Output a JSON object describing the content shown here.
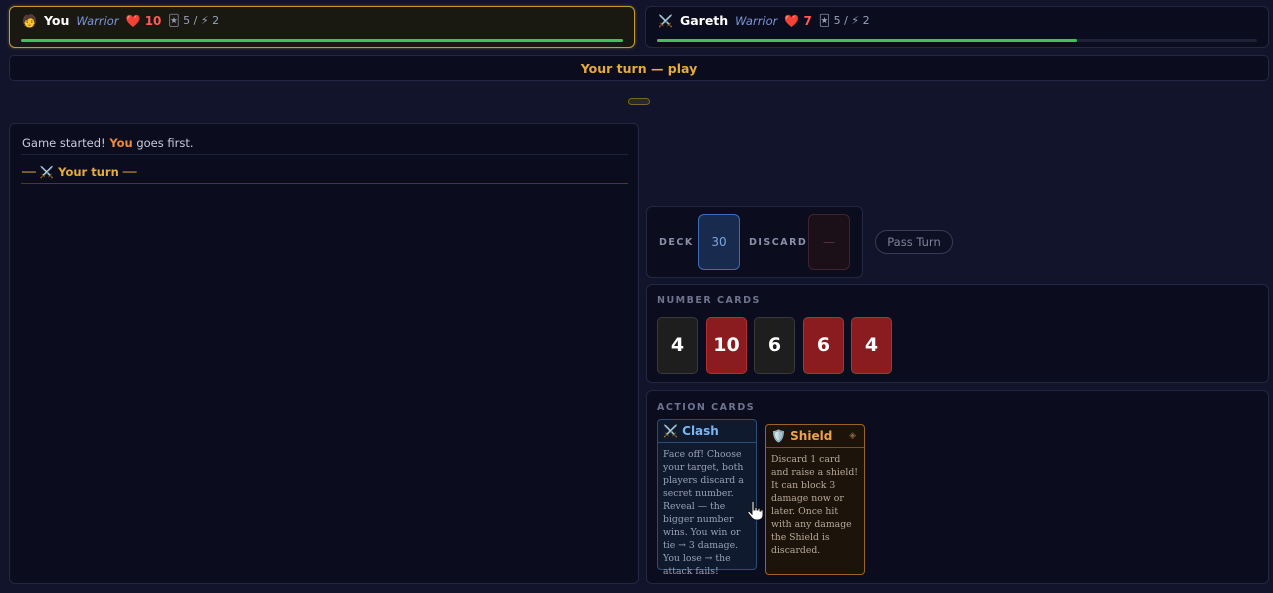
{
  "players": [
    {
      "avatar": "🧑",
      "name": "You",
      "class": "Warrior",
      "hp_icon": "❤️",
      "hp": "10",
      "cards_icon": "🃏",
      "cards": "5",
      "energy_icon": "⚡",
      "energy": "2",
      "hp_fraction": 1.0,
      "active": true
    },
    {
      "avatar": "⚔️",
      "name": "Gareth",
      "class": "Warrior",
      "hp_icon": "❤️",
      "hp": "7",
      "cards_icon": "🃏",
      "cards": "5",
      "energy_icon": "⚡",
      "energy": "2",
      "hp_fraction": 0.7,
      "active": false
    }
  ],
  "banner": "Your turn — play",
  "log": {
    "line1_pre": "Game started! ",
    "line1_bold": "You",
    "line1_post": " goes first.",
    "line2": "── ⚔️ Your turn ──"
  },
  "deck": {
    "label": "DECK",
    "count": "30",
    "discard_label": "DISCARD",
    "discard_value": "—"
  },
  "pass_button": "Pass Turn",
  "number_cards": {
    "label": "NUMBER CARDS",
    "cards": [
      {
        "value": "4",
        "color": "dark"
      },
      {
        "value": "10",
        "color": "red"
      },
      {
        "value": "6",
        "color": "dark"
      },
      {
        "value": "6",
        "color": "red"
      },
      {
        "value": "4",
        "color": "red"
      }
    ]
  },
  "action_cards": {
    "label": "ACTION CARDS",
    "cards": [
      {
        "icon": "⚔️",
        "name": "Clash",
        "desc": "Face off! Choose your target, both players discard a secret number. Reveal — the bigger number wins. You win or tie → 3 damage. You lose → the attack fails!"
      },
      {
        "icon": "🛡️",
        "name": "Shield",
        "marker": "◈",
        "desc": "Discard 1 card and raise a shield! It can block 3 damage now or later. Once hit with any damage the Shield is discarded."
      }
    ]
  },
  "colors": {
    "accent": "#e6ab38",
    "hp_bar": "#3fc25c",
    "red_card": "#8a1c20"
  }
}
